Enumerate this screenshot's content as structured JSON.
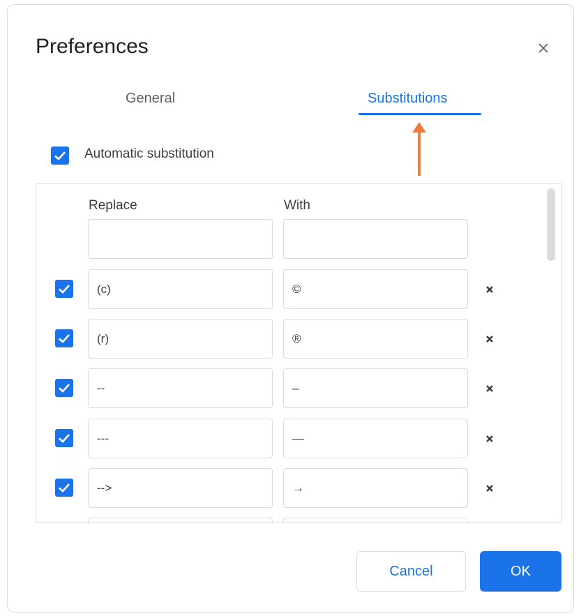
{
  "dialog": {
    "title": "Preferences",
    "close_icon": "close-icon"
  },
  "tabs": [
    {
      "label": "General",
      "active": false
    },
    {
      "label": "Substitutions",
      "active": true
    }
  ],
  "annotation": {
    "icon": "orange-arrow-up-icon",
    "color": "#f07c3c"
  },
  "auto_substitution": {
    "label": "Automatic substitution",
    "checked": true
  },
  "table": {
    "headers": {
      "replace": "Replace",
      "with": "With"
    },
    "new_row": {
      "replace": "",
      "with": ""
    },
    "rows": [
      {
        "enabled": true,
        "replace": "(c)",
        "with": "©"
      },
      {
        "enabled": true,
        "replace": "(r)",
        "with": "®"
      },
      {
        "enabled": true,
        "replace": "--",
        "with": "–"
      },
      {
        "enabled": true,
        "replace": "---",
        "with": "—"
      },
      {
        "enabled": true,
        "replace": "-->",
        "with": "→"
      }
    ]
  },
  "buttons": {
    "cancel": "Cancel",
    "ok": "OK"
  },
  "colors": {
    "accent": "#1a73e8",
    "border": "#dadce0",
    "arrow": "#f07c3c"
  }
}
